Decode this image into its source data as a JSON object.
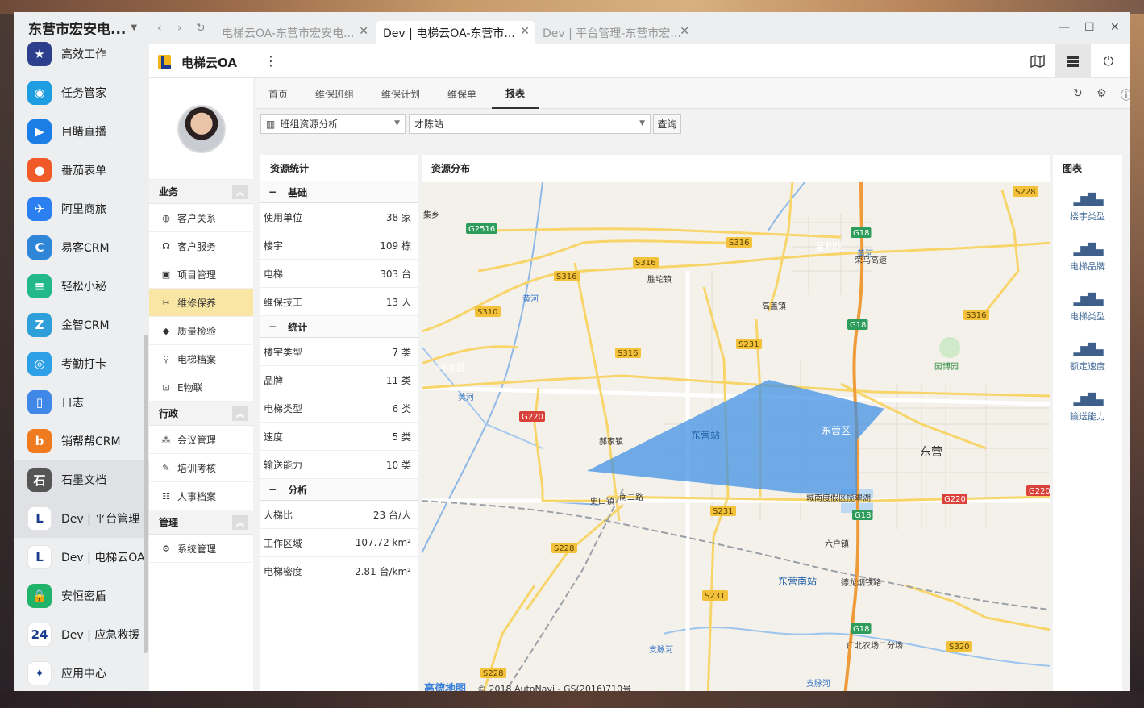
{
  "window": {
    "sidebar_title": "东营市宏安电...",
    "browser_tabs": [
      {
        "label": "电梯云OA-东营市宏安电...",
        "active": false
      },
      {
        "label": "Dev | 电梯云OA-东营市...",
        "active": true
      },
      {
        "label": "Dev | 平台管理-东营市宏...",
        "active": false
      }
    ],
    "nav_icons": [
      "back-icon",
      "forward-icon",
      "refresh-icon"
    ],
    "controls": [
      "minimize-icon",
      "maximize-icon",
      "close-icon"
    ]
  },
  "apps": [
    {
      "label": "高效工作",
      "icon": "star-icon",
      "color": "#2d3e8c",
      "glyph": "★"
    },
    {
      "label": "任务管家",
      "icon": "task-icon",
      "color": "#1e9ee0",
      "glyph": "◉"
    },
    {
      "label": "目睹直播",
      "icon": "play-icon",
      "color": "#1a7ee6",
      "glyph": "▶"
    },
    {
      "label": "番茄表单",
      "icon": "tomato-icon",
      "color": "#f05a28",
      "glyph": "●"
    },
    {
      "label": "阿里商旅",
      "icon": "travel-icon",
      "color": "#2b7ff0",
      "glyph": "✈"
    },
    {
      "label": "易客CRM",
      "icon": "crm-icon",
      "color": "#2f86d8",
      "glyph": "C"
    },
    {
      "label": "轻松小秘",
      "icon": "notebook-icon",
      "color": "#22b889",
      "glyph": "≡"
    },
    {
      "label": "金智CRM",
      "icon": "jinzhi-icon",
      "color": "#2e9fd8",
      "glyph": "Z"
    },
    {
      "label": "考勤打卡",
      "icon": "location-icon",
      "color": "#2ea0e8",
      "glyph": "◎"
    },
    {
      "label": "日志",
      "icon": "log-icon",
      "color": "#3f88e8",
      "glyph": "▯"
    },
    {
      "label": "销帮帮CRM",
      "icon": "xbb-icon",
      "color": "#f07a1e",
      "glyph": "b"
    },
    {
      "label": "石墨文档",
      "icon": "shimo-icon",
      "color": "#555555",
      "glyph": "石"
    },
    {
      "label": "Dev | 平台管理",
      "icon": "platform-icon",
      "color": "#ffffff",
      "glyph": "L"
    },
    {
      "label": "Dev | 电梯云OA",
      "icon": "elevator-oa-icon",
      "color": "#ffffff",
      "glyph": "L"
    },
    {
      "label": "安恒密盾",
      "icon": "lock-icon",
      "color": "#1fb46a",
      "glyph": "🔒"
    },
    {
      "label": "Dev | 应急救援",
      "icon": "rescue-icon",
      "color": "#ffffff",
      "glyph": "24"
    },
    {
      "label": "应用中心",
      "icon": "app-center-icon",
      "color": "#ffffff",
      "glyph": "✦"
    }
  ],
  "app": {
    "title": "电梯云OA",
    "header_buttons": [
      "map-icon",
      "grid-icon",
      "power-icon"
    ]
  },
  "nav": {
    "groups": [
      {
        "label": "业务",
        "items": [
          {
            "label": "客户关系",
            "icon": "crm-small-icon",
            "glyph": "◍"
          },
          {
            "label": "客户服务",
            "icon": "headset-icon",
            "glyph": "☊"
          },
          {
            "label": "项目管理",
            "icon": "project-icon",
            "glyph": "▣"
          },
          {
            "label": "维修保养",
            "icon": "tools-icon",
            "glyph": "✂",
            "selected": true
          },
          {
            "label": "质量检验",
            "icon": "shield-check-icon",
            "glyph": "◆"
          },
          {
            "label": "电梯档案",
            "icon": "elevator-file-icon",
            "glyph": "⚲"
          },
          {
            "label": "E物联",
            "icon": "iot-icon",
            "glyph": "⊡"
          }
        ]
      },
      {
        "label": "行政",
        "items": [
          {
            "label": "会议管理",
            "icon": "meeting-icon",
            "glyph": "⁂"
          },
          {
            "label": "培训考核",
            "icon": "training-icon",
            "glyph": "✎"
          },
          {
            "label": "人事档案",
            "icon": "personnel-icon",
            "glyph": "☷"
          }
        ]
      },
      {
        "label": "管理",
        "items": [
          {
            "label": "系统管理",
            "icon": "settings-icon",
            "glyph": "⚙"
          }
        ]
      }
    ]
  },
  "tabs": [
    {
      "label": "首页"
    },
    {
      "label": "维保班组"
    },
    {
      "label": "维保计划"
    },
    {
      "label": "维保单"
    },
    {
      "label": "报表",
      "active": true
    }
  ],
  "tab_icons": [
    "refresh-icon",
    "gear-icon",
    "help-icon"
  ],
  "toolbar": {
    "report_select": "班组资源分析",
    "station_select": "才陈站",
    "query_label": "查询"
  },
  "stats": {
    "title": "资源统计",
    "sections": [
      {
        "label": "基础",
        "rows": [
          {
            "name": "使用单位",
            "value": "38 家"
          },
          {
            "name": "楼宇",
            "value": "109 栋"
          },
          {
            "name": "电梯",
            "value": "303 台"
          },
          {
            "name": "维保技工",
            "value": "13 人"
          }
        ]
      },
      {
        "label": "统计",
        "rows": [
          {
            "name": "楼宇类型",
            "value": "7 类"
          },
          {
            "name": "品牌",
            "value": "11 类"
          },
          {
            "name": "电梯类型",
            "value": "6 类"
          },
          {
            "name": "速度",
            "value": "5 类"
          },
          {
            "name": "输送能力",
            "value": "10 类"
          }
        ]
      },
      {
        "label": "分析",
        "rows": [
          {
            "name": "人梯比",
            "value": "23 台/人"
          },
          {
            "name": "工作区域",
            "value": "107.72 km²"
          },
          {
            "name": "电梯密度",
            "value": "2.81 台/km²"
          }
        ]
      }
    ]
  },
  "map": {
    "title": "资源分布",
    "copyright": "© 2018 AutoNavi - GS(2016)710号",
    "brand": "高德地图",
    "area_color": "#3b8fe6",
    "labels": [
      "集乡",
      "G2516",
      "S316",
      "S316",
      "S316",
      "胜坨镇",
      "S310",
      "黄河",
      "利津县",
      "黄河",
      "S316",
      "高盖镇",
      "S231",
      "G18",
      "星利区",
      "G18",
      "黄河",
      "S316",
      "园博园",
      "G220",
      "郝家镇",
      "东营站",
      "东营区",
      "东营",
      "S231",
      "史口镇",
      "南二路",
      "城南度假区揽翠湖",
      "G18",
      "G220",
      "G220",
      "S228",
      "六户镇",
      "东营南站",
      "S231",
      "德龙烟铁路",
      "G18",
      "支脉河",
      "广北农场二分场",
      "S320",
      "S228",
      "支脉河",
      "S228",
      "荣乌高速"
    ]
  },
  "charts": {
    "title": "图表",
    "items": [
      {
        "label": "楼宇类型"
      },
      {
        "label": "电梯品牌"
      },
      {
        "label": "电梯类型"
      },
      {
        "label": "额定速度"
      },
      {
        "label": "输送能力"
      }
    ]
  }
}
